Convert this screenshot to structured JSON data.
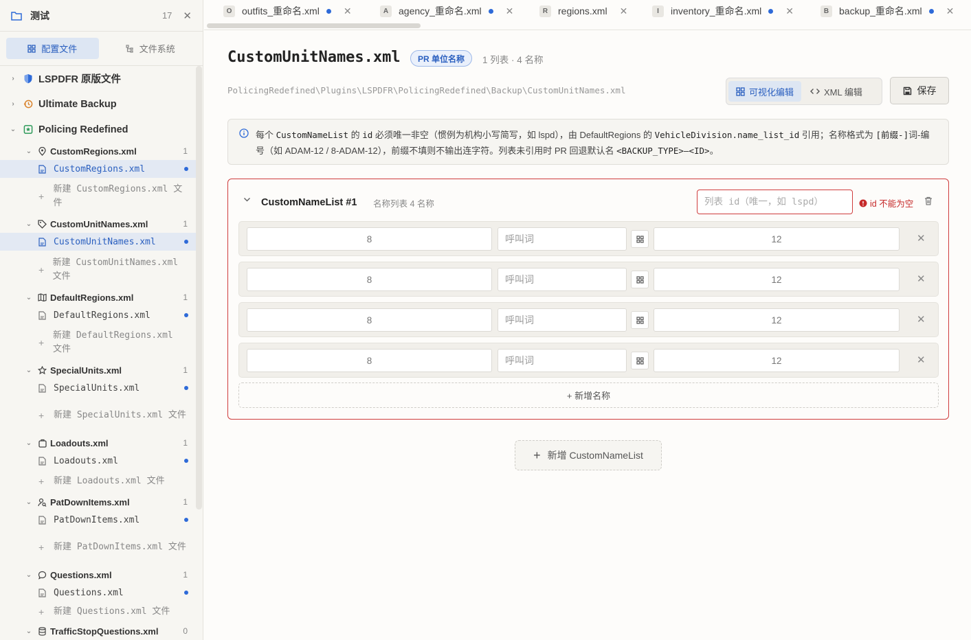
{
  "workspace": {
    "name": "测试",
    "count": "17"
  },
  "sidebar_tabs": [
    {
      "label": "配置文件",
      "active": true
    },
    {
      "label": "文件系统",
      "active": false
    }
  ],
  "groups": [
    {
      "label": "LSPDFR 原版文件",
      "expanded": false
    },
    {
      "label": "Ultimate Backup",
      "expanded": false
    },
    {
      "label": "Policing Redefined",
      "expanded": true
    }
  ],
  "files": [
    {
      "name": "CustomRegions.xml",
      "count": "1",
      "icon": "map-pin-icon",
      "sub": "CustomRegions.xml",
      "active": true,
      "new_label": "新建 CustomRegions.xml 文件"
    },
    {
      "name": "CustomUnitNames.xml",
      "count": "1",
      "icon": "tag-icon",
      "sub": "CustomUnitNames.xml",
      "active": true,
      "new_label": "新建 CustomUnitNames.xml 文件"
    },
    {
      "name": "DefaultRegions.xml",
      "count": "1",
      "icon": "map-icon",
      "sub": "DefaultRegions.xml",
      "active": false,
      "new_label": "新建 DefaultRegions.xml 文件"
    },
    {
      "name": "SpecialUnits.xml",
      "count": "1",
      "icon": "star-icon",
      "sub": "SpecialUnits.xml",
      "active": false,
      "new_label": "新建 SpecialUnits.xml 文件"
    },
    {
      "name": "Loadouts.xml",
      "count": "1",
      "icon": "briefcase-icon",
      "sub": "Loadouts.xml",
      "active": false,
      "new_label": "新建 Loadouts.xml 文件"
    },
    {
      "name": "PatDownItems.xml",
      "count": "1",
      "icon": "user-search-icon",
      "sub": "PatDownItems.xml",
      "active": false,
      "new_label": "新建 PatDownItems.xml 文件"
    },
    {
      "name": "Questions.xml",
      "count": "1",
      "icon": "speech-bubble-icon",
      "sub": "Questions.xml",
      "active": false,
      "new_label": "新建 Questions.xml 文件"
    },
    {
      "name": "TrafficStopQuestions.xml",
      "count": "0",
      "icon": "database-icon",
      "sub": "",
      "active": false,
      "new_label": ""
    }
  ],
  "tabs": [
    {
      "badge": "O",
      "label": "outfits_重命名.xml",
      "modified": true
    },
    {
      "badge": "A",
      "label": "agency_重命名.xml",
      "modified": true
    },
    {
      "badge": "R",
      "label": "regions.xml",
      "modified": false
    },
    {
      "badge": "I",
      "label": "inventory_重命名.xml",
      "modified": true
    },
    {
      "badge": "B",
      "label": "backup_重命名.xml",
      "modified": true
    }
  ],
  "editor": {
    "title": "CustomUnitNames.xml",
    "pill": "PR 单位名称",
    "meta": "1 列表 · 4 名称",
    "path": "PolicingRedefined\\Plugins\\LSPDFR\\PolicingRedefined\\Backup\\CustomUnitNames.xml",
    "mode_visual": "可视化编辑",
    "mode_xml": "XML 编辑",
    "save": "保存",
    "info": {
      "t1": "每个 ",
      "c1": "CustomNameList",
      "t2": " 的 ",
      "c2": "id",
      "t3": " 必须唯一非空（惯例为机构小写简写，如 lspd），由 DefaultRegions 的 ",
      "c3": "VehicleDivision.name_list_id",
      "t4": " 引用；名称格式为 ",
      "c4": "[前缀-]",
      "t5": "词-编号（如 ADAM-12 / 8-ADAM-12），前缀不填则不输出连字符。列表未引用时 PR 回退默认名 ",
      "c5": "<BACKUP_TYPE>—<ID>",
      "t6": "。"
    }
  },
  "card": {
    "title": "CustomNameList #1",
    "sub": "名称列表  4  名称",
    "id_placeholder": "列表 id（唯一，如 lspd）",
    "error": "id 不能为空",
    "rows": [
      {
        "prefix": "8",
        "word_placeholder": "呼叫词",
        "number": "12"
      },
      {
        "prefix": "8",
        "word_placeholder": "呼叫词",
        "number": "12"
      },
      {
        "prefix": "8",
        "word_placeholder": "呼叫词",
        "number": "12"
      },
      {
        "prefix": "8",
        "word_placeholder": "呼叫词",
        "number": "12"
      }
    ],
    "add_name": "+ 新增名称"
  },
  "add_list": "新增 CustomNameList"
}
